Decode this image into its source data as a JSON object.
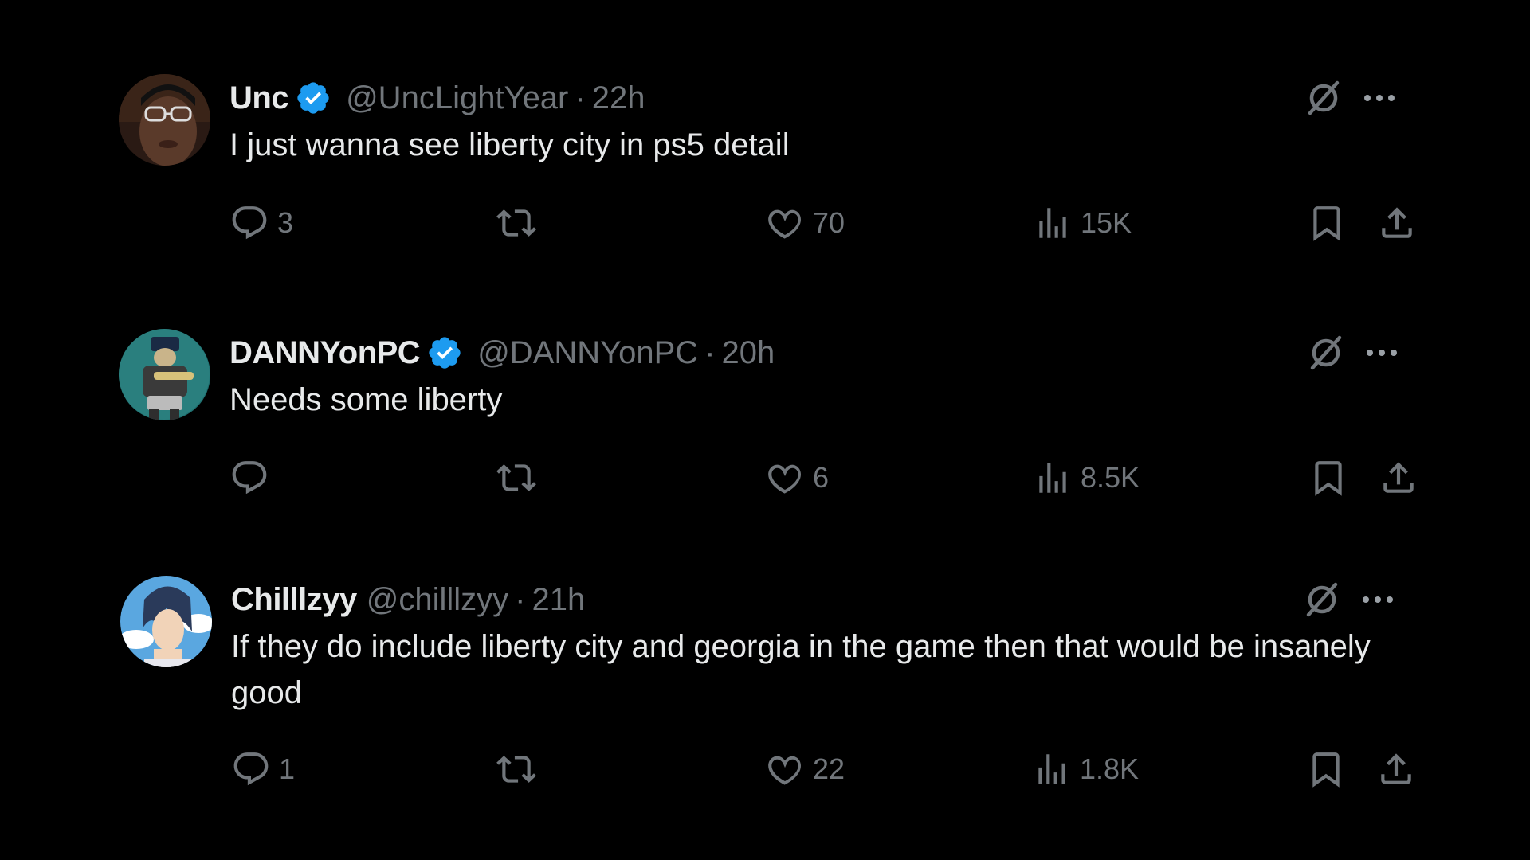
{
  "colors": {
    "background": "#000000",
    "text_primary": "#e7e9ea",
    "text_secondary": "#71767b",
    "verified_blue": "#1d9bf0"
  },
  "tweets": [
    {
      "display_name": "Unc",
      "verified": true,
      "handle": "@UncLightYear",
      "separator": "·",
      "time": "22h",
      "text": "I just wanna see liberty city in ps5 detail",
      "replies": "3",
      "likes": "70",
      "views": "15K"
    },
    {
      "display_name": "DANNYonPC",
      "verified": true,
      "handle": "@DANNYonPC",
      "separator": "·",
      "time": "20h",
      "text": "Needs some liberty",
      "replies": "",
      "likes": "6",
      "views": "8.5K"
    },
    {
      "display_name": "Chilllzyy",
      "verified": false,
      "handle": "@chilllzyy",
      "separator": "·",
      "time": "21h",
      "text": "If they do include liberty city and georgia in the game then that would be insanely good",
      "replies": "1",
      "likes": "22",
      "views": "1.8K"
    }
  ],
  "icons": {
    "reply": "reply-icon",
    "retweet": "retweet-icon",
    "like": "heart-icon",
    "views": "views-bar-chart-icon",
    "bookmark": "bookmark-icon",
    "share": "share-icon",
    "grok": "grok-icon",
    "more": "more-icon"
  }
}
